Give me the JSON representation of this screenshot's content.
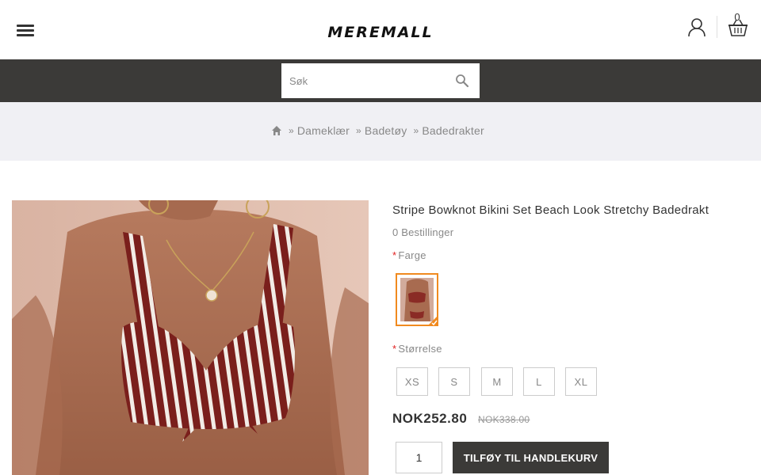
{
  "header": {
    "logo_text": "MEREMALL",
    "cart_count": "0"
  },
  "search": {
    "placeholder": "Søk"
  },
  "breadcrumb": {
    "items": [
      "Dameklær",
      "Badetøy",
      "Badedrakter"
    ]
  },
  "product": {
    "title": "Stripe Bowknot Bikini Set Beach Look Stretchy Badedrakt",
    "orders": "0 Bestillinger",
    "color_label": "Farge",
    "size_label": "Størrelse",
    "sizes": [
      "XS",
      "S",
      "M",
      "L",
      "XL"
    ],
    "price": "NOK252.80",
    "old_price": "NOK338.00",
    "quantity": "1",
    "add_to_cart_label": "TILFØY TIL HANDLEKURV",
    "required_mark": "*"
  },
  "colors": {
    "dark_bar": "#3b3a38",
    "breadcrumb_bg": "#f0f0f4",
    "swatch_selected": "#f08a1f",
    "required": "#e01f1f"
  },
  "icons": {
    "menu": "hamburger-icon",
    "account": "user-icon",
    "cart": "basket-icon",
    "search": "search-icon",
    "home": "home-icon"
  }
}
